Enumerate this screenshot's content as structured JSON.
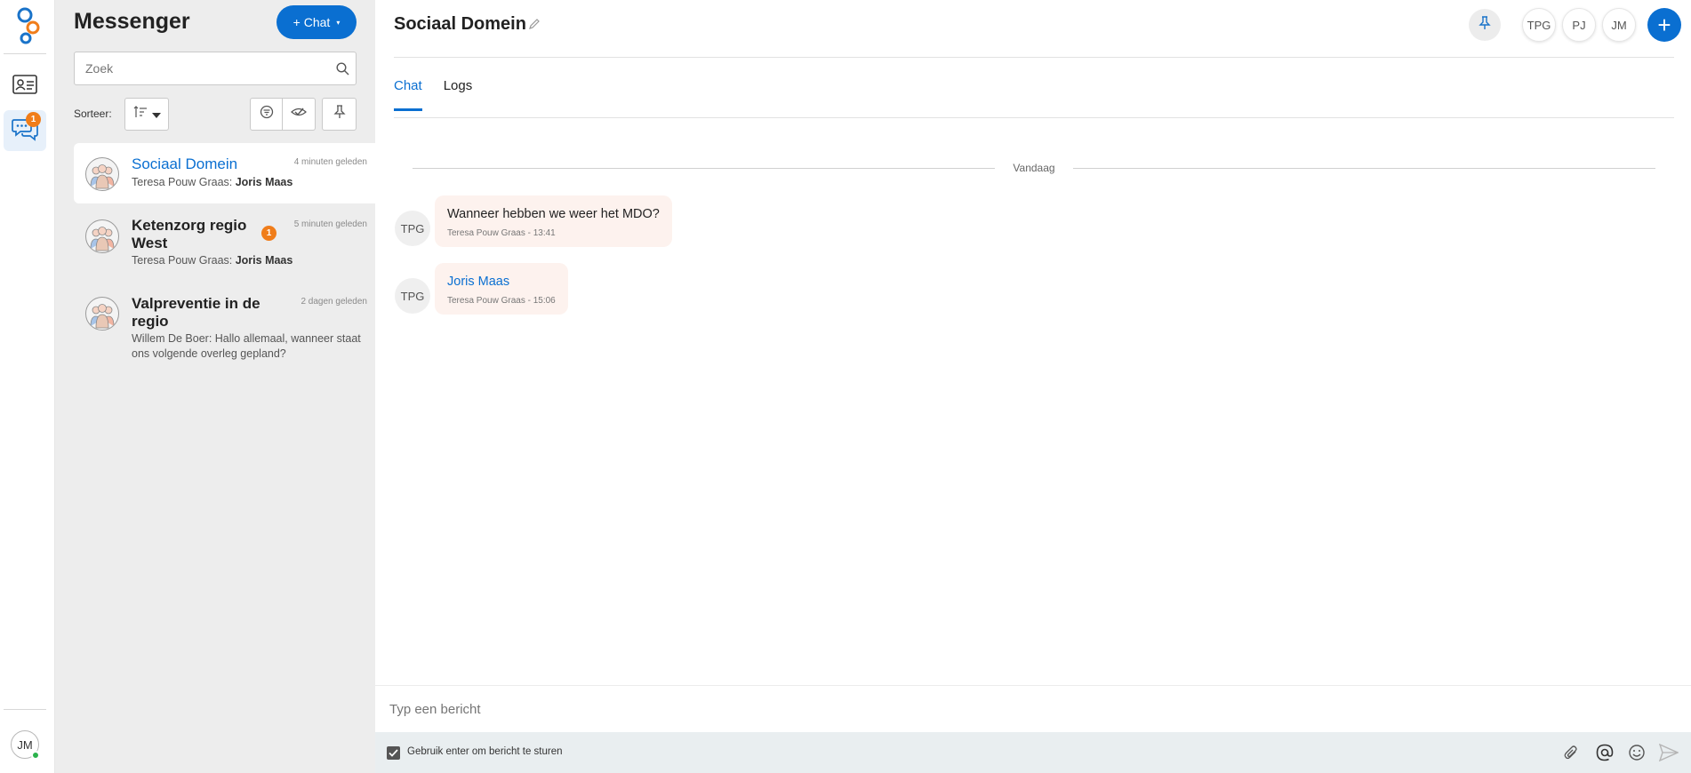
{
  "app": {
    "title": "Messenger",
    "new_chat_label": "+ Chat",
    "new_chat_caret": "▾"
  },
  "rail": {
    "chat_badge": "1",
    "user_initials": "JM",
    "icons": [
      "logo-icon",
      "contact-card-icon",
      "chat-bubbles-icon"
    ]
  },
  "search": {
    "placeholder": "Zoek"
  },
  "sort": {
    "label": "Sorteer:"
  },
  "conversations": [
    {
      "name": "Sociaal Domein",
      "time": "4 minuten geleden",
      "preview_sender": "Teresa Pouw Graas: ",
      "preview_text": "Joris Maas",
      "selected": true
    },
    {
      "name": "Ketenzorg regio West",
      "time": "5 minuten geleden",
      "preview_sender": "Teresa Pouw Graas: ",
      "preview_text": "Joris Maas",
      "badge": "1"
    },
    {
      "name": "Valpreventie in de regio",
      "time": "2 dagen geleden",
      "preview_full": "Willem De Boer: Hallo allemaal, wanneer staat ons volgende overleg gepland?"
    }
  ],
  "chat": {
    "title": "Sociaal Domein",
    "participants": [
      "TPG",
      "PJ",
      "JM"
    ],
    "add_label": "+",
    "tabs": [
      {
        "label": "Chat",
        "active": true
      },
      {
        "label": "Logs",
        "active": false
      }
    ],
    "date_divider": "Vandaag",
    "messages": [
      {
        "avatar": "TPG",
        "text": "Wanneer hebben we weer het MDO?",
        "meta": "Teresa Pouw Graas - 13:41",
        "mention": false
      },
      {
        "avatar": "TPG",
        "text": "Joris Maas",
        "meta": "Teresa Pouw Graas - 15:06",
        "mention": true
      }
    ]
  },
  "composer": {
    "placeholder": "Typ een bericht",
    "enter_to_send_label": "Gebruik enter om bericht te sturen",
    "enter_to_send_checked": true
  },
  "colors": {
    "accent": "#0a6fd1",
    "badge": "#f07d1a",
    "bubble": "#fdf2ee",
    "online": "#2bb24c"
  }
}
